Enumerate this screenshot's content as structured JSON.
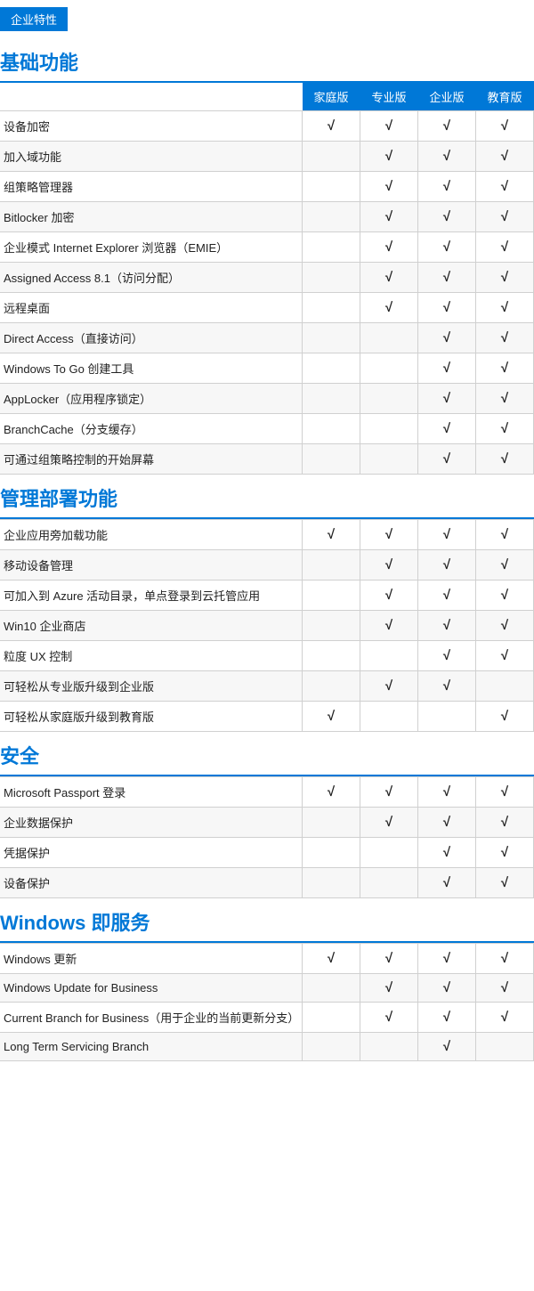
{
  "badge": "企业特性",
  "columns": [
    "家庭版",
    "专业版",
    "企业版",
    "教育版"
  ],
  "sections": [
    {
      "title": "基础功能",
      "is_badge": true,
      "rows": [
        {
          "name": "设备加密",
          "checks": [
            true,
            true,
            true,
            true
          ]
        },
        {
          "name": "加入域功能",
          "checks": [
            false,
            true,
            true,
            true
          ]
        },
        {
          "name": "组策略管理器",
          "checks": [
            false,
            true,
            true,
            true
          ]
        },
        {
          "name": "Bitlocker 加密",
          "checks": [
            false,
            true,
            true,
            true
          ]
        },
        {
          "name": "企业模式 Internet Explorer 浏览器（EMIE）",
          "checks": [
            false,
            true,
            true,
            true
          ]
        },
        {
          "name": "Assigned Access 8.1（访问分配）",
          "checks": [
            false,
            true,
            true,
            true
          ]
        },
        {
          "name": "远程桌面",
          "checks": [
            false,
            true,
            true,
            true
          ]
        },
        {
          "name": "Direct Access（直接访问）",
          "checks": [
            false,
            false,
            true,
            true
          ]
        },
        {
          "name": "Windows To Go 创建工具",
          "checks": [
            false,
            false,
            true,
            true
          ]
        },
        {
          "name": "AppLocker（应用程序锁定）",
          "checks": [
            false,
            false,
            true,
            true
          ]
        },
        {
          "name": "BranchCache（分支缓存）",
          "checks": [
            false,
            false,
            true,
            true
          ]
        },
        {
          "name": "可通过组策略控制的开始屏幕",
          "checks": [
            false,
            false,
            true,
            true
          ]
        }
      ]
    },
    {
      "title": "管理部署功能",
      "is_badge": false,
      "rows": [
        {
          "name": "企业应用旁加载功能",
          "checks": [
            true,
            true,
            true,
            true
          ]
        },
        {
          "name": "移动设备管理",
          "checks": [
            false,
            true,
            true,
            true
          ]
        },
        {
          "name": "可加入到 Azure 活动目录，单点登录到云托管应用",
          "checks": [
            false,
            true,
            true,
            true
          ]
        },
        {
          "name": "Win10 企业商店",
          "checks": [
            false,
            true,
            true,
            true
          ]
        },
        {
          "name": "粒度 UX 控制",
          "checks": [
            false,
            false,
            true,
            true
          ]
        },
        {
          "name": "可轻松从专业版升级到企业版",
          "checks": [
            false,
            true,
            true,
            false
          ]
        },
        {
          "name": "可轻松从家庭版升级到教育版",
          "checks": [
            true,
            false,
            false,
            true
          ]
        }
      ]
    },
    {
      "title": "安全",
      "is_badge": false,
      "rows": [
        {
          "name": "Microsoft Passport 登录",
          "checks": [
            true,
            true,
            true,
            true
          ]
        },
        {
          "name": "企业数据保护",
          "checks": [
            false,
            true,
            true,
            true
          ]
        },
        {
          "name": "凭据保护",
          "checks": [
            false,
            false,
            true,
            true
          ]
        },
        {
          "name": "设备保护",
          "checks": [
            false,
            false,
            true,
            true
          ]
        }
      ]
    },
    {
      "title": "Windows 即服务",
      "is_badge": false,
      "rows": [
        {
          "name": "Windows 更新",
          "checks": [
            true,
            true,
            true,
            true
          ]
        },
        {
          "name": "Windows Update for Business",
          "checks": [
            false,
            true,
            true,
            true
          ]
        },
        {
          "name": "Current Branch for Business（用于企业的当前更新分支）",
          "checks": [
            false,
            true,
            true,
            true
          ]
        },
        {
          "name": "Long Term Servicing Branch",
          "checks": [
            false,
            false,
            true,
            false
          ]
        }
      ]
    }
  ],
  "check_symbol": "√"
}
